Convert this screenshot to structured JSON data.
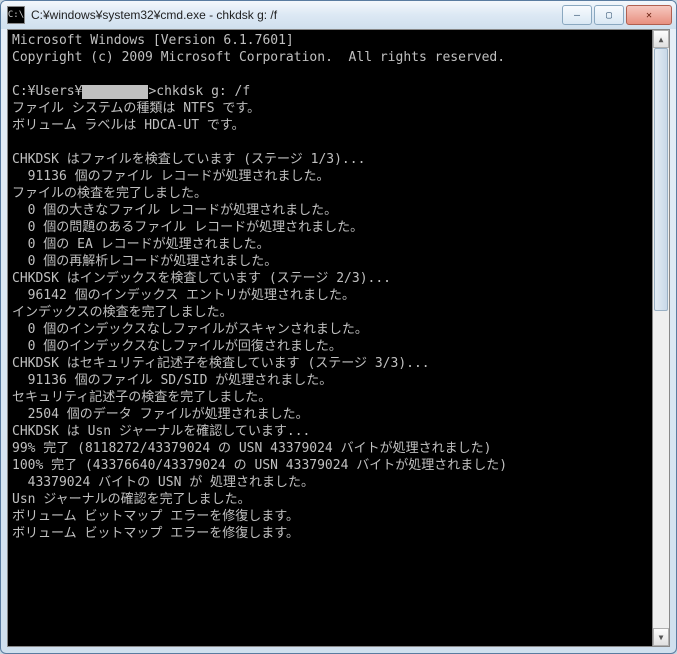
{
  "window": {
    "icon_label": "C:\\",
    "title": "C:¥windows¥system32¥cmd.exe - chkdsk  g: /f"
  },
  "term": {
    "l01": "Microsoft Windows [Version 6.1.7601]",
    "l02": "Copyright (c) 2009 Microsoft Corporation.  All rights reserved.",
    "l03": "",
    "prompt_prefix": "C:¥Users¥",
    "prompt_suffix": ">chkdsk g: /f",
    "l05": "ファイル システムの種類は NTFS です。",
    "l06": "ボリューム ラベルは HDCA-UT です。",
    "l07": "",
    "l08": "CHKDSK はファイルを検査しています (ステージ 1/3)...",
    "l09": "  91136 個のファイル レコードが処理されました。",
    "l10": "ファイルの検査を完了しました。",
    "l11": "  0 個の大きなファイル レコードが処理されました。",
    "l12": "  0 個の問題のあるファイル レコードが処理されました。",
    "l13": "  0 個の EA レコードが処理されました。",
    "l14": "  0 個の再解析レコードが処理されました。",
    "l15": "CHKDSK はインデックスを検査しています (ステージ 2/3)...",
    "l16": "  96142 個のインデックス エントリが処理されました。",
    "l17": "インデックスの検査を完了しました。",
    "l18": "  0 個のインデックスなしファイルがスキャンされました。",
    "l19": "  0 個のインデックスなしファイルが回復されました。",
    "l20": "CHKDSK はセキュリティ記述子を検査しています (ステージ 3/3)...",
    "l21": "  91136 個のファイル SD/SID が処理されました。",
    "l22": "セキュリティ記述子の検査を完了しました。",
    "l23": "  2504 個のデータ ファイルが処理されました。",
    "l24": "CHKDSK は Usn ジャーナルを確認しています...",
    "l25": "99% 完了 (8118272/43379024 の USN 43379024 バイトが処理されました)",
    "l26": "100% 完了 (43376640/43379024 の USN 43379024 バイトが処理されました)",
    "l27": "  43379024 バイトの USN が 処理されました。",
    "l28": "Usn ジャーナルの確認を完了しました。",
    "l29": "ボリューム ビットマップ エラーを修復します。",
    "l30": "ボリューム ビットマップ エラーを修復します。"
  },
  "controls": {
    "minimize": "—",
    "maximize": "▢",
    "close": "✕",
    "scroll_up": "▲",
    "scroll_down": "▼"
  }
}
